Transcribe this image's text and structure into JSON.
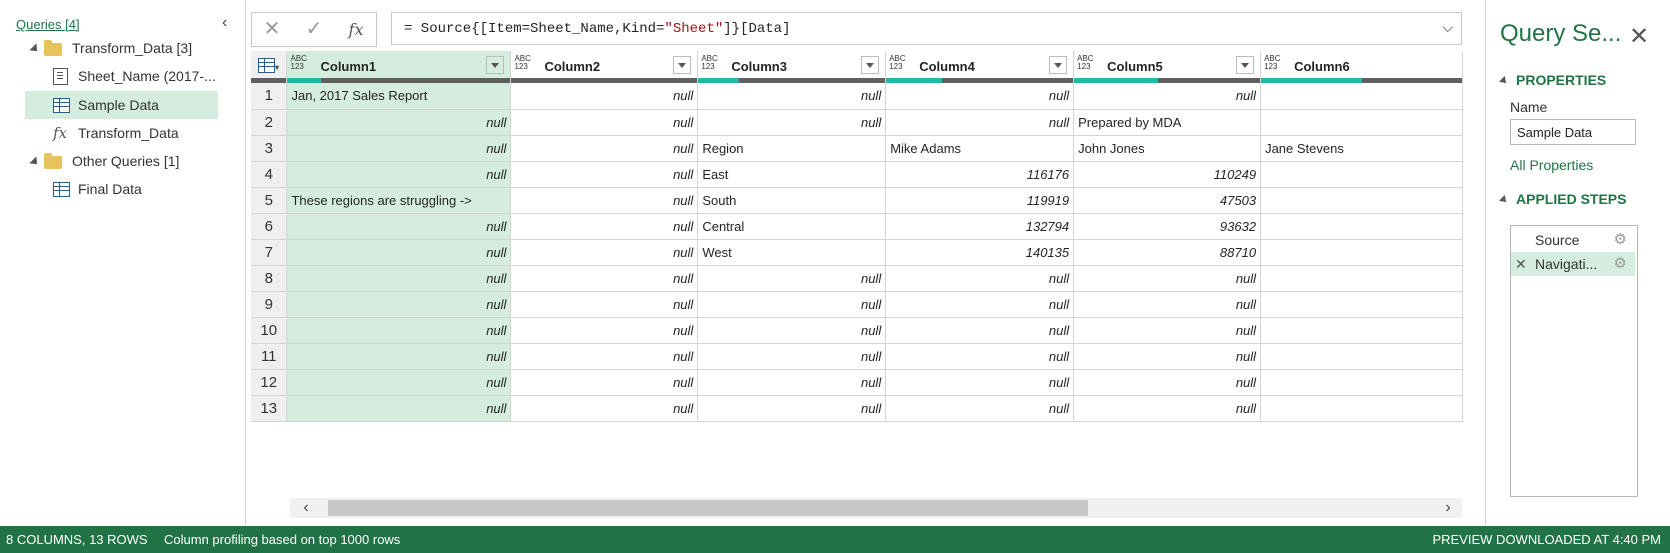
{
  "queries_pane": {
    "header": "Queries [4]",
    "items": [
      {
        "label": "Transform_Data [3]",
        "type": "folder"
      },
      {
        "label": "Sheet_Name (2017-...",
        "type": "sheet"
      },
      {
        "label": "Sample Data",
        "type": "table",
        "selected": true
      },
      {
        "label": "Transform_Data",
        "type": "function"
      },
      {
        "label": "Other Queries [1]",
        "type": "folder"
      },
      {
        "label": "Final Data",
        "type": "table"
      }
    ]
  },
  "formula_bar": {
    "cancel_icon": "✕",
    "commit_icon": "✓",
    "fx_label": "fx",
    "prefix": "= Source{[Item=Sheet_Name,Kind=",
    "string_literal": "\"Sheet\"",
    "suffix": "]}[Data]",
    "expand_icon": "chevron-down-icon"
  },
  "grid": {
    "type_label_top": "ABC",
    "type_label_bottom": "123",
    "columns": [
      {
        "name": "Column1",
        "quality_fill": 0.15
      },
      {
        "name": "Column2",
        "quality_fill": 0.0
      },
      {
        "name": "Column3",
        "quality_fill": 0.22
      },
      {
        "name": "Column4",
        "quality_fill": 0.3
      },
      {
        "name": "Column5",
        "quality_fill": 0.45
      },
      {
        "name": "Column6",
        "quality_fill": 0.5
      }
    ],
    "rows": [
      {
        "n": "1",
        "c": [
          "Jan, 2017 Sales Report",
          "null",
          "null",
          "null",
          "null",
          ""
        ]
      },
      {
        "n": "2",
        "c": [
          "null",
          "null",
          "null",
          "null",
          "Prepared by MDA",
          ""
        ]
      },
      {
        "n": "3",
        "c": [
          "null",
          "null",
          "Region",
          "Mike Adams",
          "John Jones",
          "Jane Stevens"
        ]
      },
      {
        "n": "4",
        "c": [
          "null",
          "null",
          "East",
          "116176",
          "110249",
          ""
        ]
      },
      {
        "n": "5",
        "c": [
          "These regions are struggling ->",
          "null",
          "South",
          "119919",
          "47503",
          ""
        ]
      },
      {
        "n": "6",
        "c": [
          "null",
          "null",
          "Central",
          "132794",
          "93632",
          ""
        ]
      },
      {
        "n": "7",
        "c": [
          "null",
          "null",
          "West",
          "140135",
          "88710",
          ""
        ]
      },
      {
        "n": "8",
        "c": [
          "null",
          "null",
          "null",
          "null",
          "null",
          ""
        ]
      },
      {
        "n": "9",
        "c": [
          "null",
          "null",
          "null",
          "null",
          "null",
          ""
        ]
      },
      {
        "n": "10",
        "c": [
          "null",
          "null",
          "null",
          "null",
          "null",
          ""
        ]
      },
      {
        "n": "11",
        "c": [
          "null",
          "null",
          "null",
          "null",
          "null",
          ""
        ]
      },
      {
        "n": "12",
        "c": [
          "null",
          "null",
          "null",
          "null",
          "null",
          ""
        ]
      },
      {
        "n": "13",
        "c": [
          "null",
          "null",
          "null",
          "null",
          "null",
          ""
        ]
      }
    ]
  },
  "query_settings": {
    "title": "Query Se...",
    "close_icon": "✕",
    "properties_header": "PROPERTIES",
    "name_label": "Name",
    "name_value": "Sample Data",
    "all_properties_link": "All Properties",
    "applied_steps_header": "APPLIED STEPS",
    "steps": [
      {
        "label": "Source",
        "selected": false
      },
      {
        "label": "Navigati...",
        "selected": true
      }
    ]
  },
  "status_bar": {
    "counts": "8 COLUMNS, 13 ROWS",
    "profiling": "Column profiling based on top 1000 rows",
    "preview": "PREVIEW DOWNLOADED AT 4:40 PM"
  },
  "colors": {
    "accent": "#217346",
    "selection": "#d4eddf",
    "quality_valid": "#25b6a6"
  }
}
